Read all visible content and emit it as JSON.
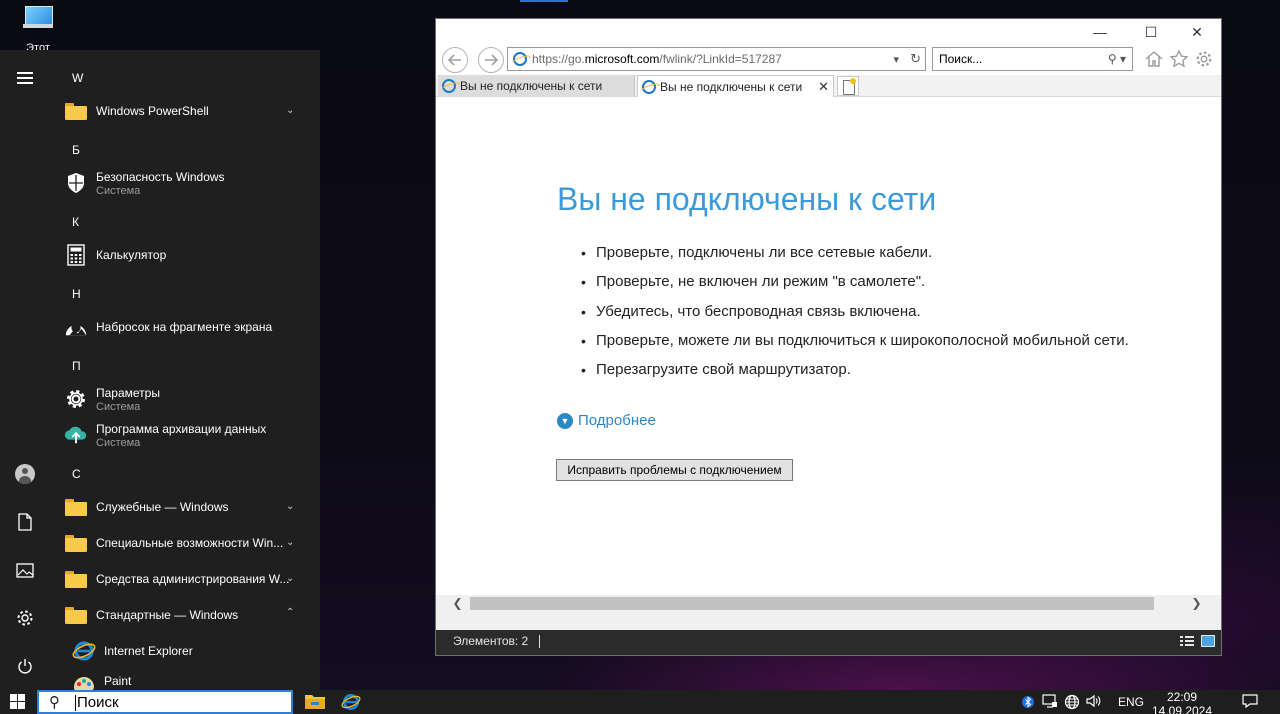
{
  "desktop": {
    "this_pc_label": "Этот"
  },
  "start_menu": {
    "rail": {
      "menu_icon": "hamburger-icon",
      "user_icon": "user-icon",
      "documents_icon": "document-icon",
      "pictures_icon": "pictures-icon",
      "settings_icon": "gear-icon",
      "power_icon": "power-icon"
    },
    "letters": [
      "W",
      "Б",
      "К",
      "Н",
      "П",
      "С"
    ],
    "apps": [
      {
        "name": "Windows PowerShell",
        "sub": "",
        "icon": "folder-icon",
        "chevron": "down"
      },
      {
        "name": "Безопасность Windows",
        "sub": "Система",
        "icon": "shield-icon",
        "chevron": ""
      },
      {
        "name": "Калькулятор",
        "sub": "",
        "icon": "calculator-icon",
        "chevron": ""
      },
      {
        "name": "Набросок на фрагменте экрана",
        "sub": "",
        "icon": "snip-sketch-icon",
        "chevron": ""
      },
      {
        "name": "Параметры",
        "sub": "Система",
        "icon": "gear-icon",
        "chevron": ""
      },
      {
        "name": "Программа архивации данных",
        "sub": "Система",
        "icon": "backup-icon",
        "chevron": ""
      },
      {
        "name": "Служебные — Windows",
        "sub": "",
        "icon": "folder-icon",
        "chevron": "down"
      },
      {
        "name": "Специальные возможности Win...",
        "sub": "",
        "icon": "folder-icon",
        "chevron": "down"
      },
      {
        "name": "Средства администрирования W...",
        "sub": "",
        "icon": "folder-icon",
        "chevron": "down"
      },
      {
        "name": "Стандартные — Windows",
        "sub": "",
        "icon": "folder-icon",
        "chevron": "up"
      },
      {
        "name": "Internet Explorer",
        "sub": "",
        "icon": "internet-explorer-icon",
        "chevron": ""
      },
      {
        "name": "Paint",
        "sub": "",
        "icon": "paint-icon",
        "chevron": ""
      }
    ]
  },
  "browser": {
    "caption": {
      "minimize": "—",
      "maximize": "☐",
      "close": "✕"
    },
    "address": {
      "prefix": "https://go.",
      "domain": "microsoft.com",
      "path": "/fwlink/?LinkId=517287",
      "dropdown": "▾",
      "refresh": "↻"
    },
    "search": {
      "placeholder": "Поиск...",
      "glyph": "⚲ ▾"
    },
    "tools": {
      "home": "home-icon",
      "favorites": "star-icon",
      "settings": "gear-icon"
    },
    "tabs": [
      {
        "title": "Вы не подключены к сети",
        "active": false
      },
      {
        "title": "Вы не подключены к сети",
        "active": true,
        "close": "✕"
      }
    ],
    "page": {
      "title": "Вы не подключены к сети",
      "bullets": [
        "Проверьте, подключены ли все сетевые кабели.",
        "Проверьте, не включен ли режим \"в самолете\".",
        "Убедитесь, что беспроводная связь включена.",
        "Проверьте, можете ли вы подключиться к широкополосной мобильной сети.",
        "Перезагрузите свой маршрутизатор."
      ],
      "more_link": "Подробнее",
      "fix_button": "Исправить проблемы с подключением"
    },
    "statusbar": {
      "text": "Элементов: 2"
    }
  },
  "taskbar": {
    "search_placeholder": "Поиск",
    "apps": [
      "file-explorer-icon",
      "internet-explorer-icon"
    ],
    "tray": {
      "lang": "ENG",
      "time": "22:09",
      "date": "14.09.2024"
    }
  },
  "colors": {
    "accent": "#3d9ad8",
    "link": "#2b87c5",
    "start_bg": "#1f1f1f",
    "taskbar_search_border": "#2f7fd6"
  }
}
